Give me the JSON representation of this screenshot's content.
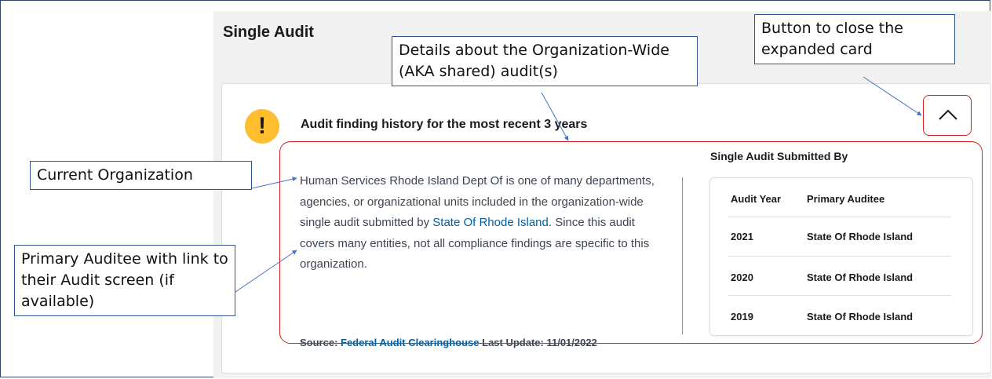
{
  "section": {
    "title": "Single Audit"
  },
  "card": {
    "heading": "Audit finding history for the most recent 3 years",
    "description_before": "Human Services Rhode Island Dept Of is one of many departments, agencies, or organizational units included in the organization-wide single audit submitted by ",
    "primary_auditee_link": "State Of Rhode Island",
    "description_after": ". Since this audit covers many entities, not all compliance findings are specific to this organization.",
    "source_label": "Source: ",
    "source_link": "Federal Audit Clearinghouse",
    "last_update": " Last Update: 11/01/2022"
  },
  "submitted_by": {
    "title": "Single Audit Submitted By",
    "columns": [
      "Audit Year",
      "Primary Auditee"
    ],
    "rows": [
      [
        "2021",
        "State Of Rhode Island"
      ],
      [
        "2020",
        "State Of Rhode Island"
      ],
      [
        "2019",
        "State Of Rhode Island"
      ]
    ]
  },
  "callouts": {
    "details": "Details about the Organization-Wide (AKA shared) audit(s)",
    "close": "Button to close the expanded card",
    "current_org": "Current Organization",
    "primary_auditee": "Primary Auditee with link to their Audit screen (if available)"
  },
  "icons": {
    "warning": "exclamation-icon",
    "close": "chevron-up-icon"
  },
  "colors": {
    "warning": "#ffbe2e",
    "link": "#005ea2",
    "highlight": "#d81e1e",
    "callout_border": "#2f5597"
  }
}
